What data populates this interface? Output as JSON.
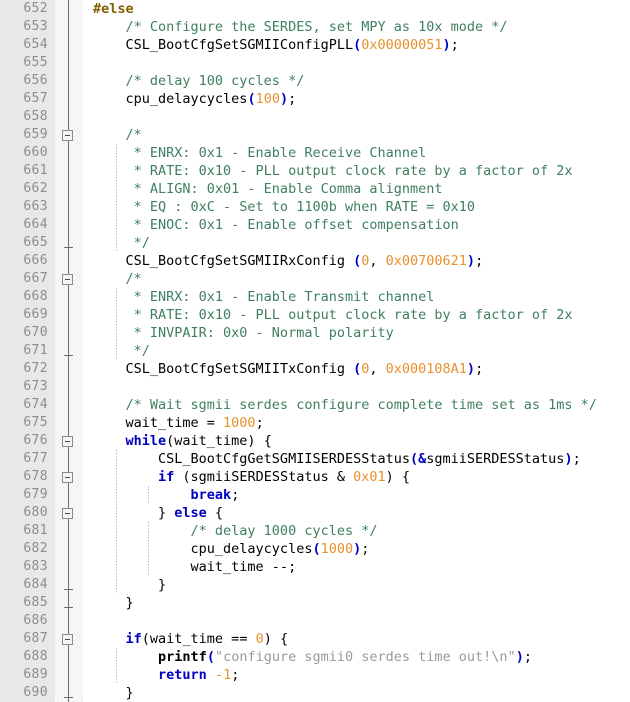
{
  "editor": {
    "name": "code-editor",
    "first_line": 652,
    "last_line": 690,
    "line_height": 18,
    "colors": {
      "gutter_bg": "#e8e8e8",
      "gutter_fg": "#8c8c8c",
      "code_bg": "#ffffff",
      "comment": "#3f7f5f",
      "keyword": "#0000c0",
      "preprocessor": "#7f5f00",
      "number": "#e8912d",
      "string": "#9a9a9a",
      "punctuation": "#0000c0",
      "indent_guide": "#bdbdbd",
      "fold_line": "#6e6e6e"
    }
  },
  "line_numbers": [
    "652",
    "653",
    "654",
    "655",
    "656",
    "657",
    "658",
    "659",
    "660",
    "661",
    "662",
    "663",
    "664",
    "665",
    "666",
    "667",
    "668",
    "669",
    "670",
    "671",
    "672",
    "673",
    "674",
    "675",
    "676",
    "677",
    "678",
    "679",
    "680",
    "681",
    "682",
    "683",
    "684",
    "685",
    "686",
    "687",
    "688",
    "689",
    "690"
  ],
  "lines": [
    {
      "number": "652",
      "fold": {
        "line": true,
        "box": false,
        "tick_top": false,
        "tick_bottom": false
      },
      "guides": [],
      "tokens": [
        {
          "t": "#else",
          "c": "pre"
        }
      ]
    },
    {
      "number": "653",
      "fold": {
        "line": true,
        "box": false,
        "tick_top": false,
        "tick_bottom": false
      },
      "guides": [],
      "tokens": [
        {
          "t": "    /* Configure the SERDES, set MPY as 10x mode */",
          "c": "cmt"
        }
      ]
    },
    {
      "number": "654",
      "fold": {
        "line": true,
        "box": false,
        "tick_top": false,
        "tick_bottom": false
      },
      "guides": [],
      "tokens": [
        {
          "t": "    CSL_BootCfgSetSGMIIConfigPLL",
          "c": "id"
        },
        {
          "t": "(",
          "c": "punc"
        },
        {
          "t": "0x00000051",
          "c": "num"
        },
        {
          "t": ")",
          "c": "punc"
        },
        {
          "t": ";",
          "c": "op"
        }
      ]
    },
    {
      "number": "655",
      "fold": {
        "line": true,
        "box": false,
        "tick_top": false,
        "tick_bottom": false
      },
      "guides": [],
      "tokens": []
    },
    {
      "number": "656",
      "fold": {
        "line": true,
        "box": false,
        "tick_top": false,
        "tick_bottom": false
      },
      "guides": [],
      "tokens": [
        {
          "t": "    /* delay 100 cycles */",
          "c": "cmt"
        }
      ]
    },
    {
      "number": "657",
      "fold": {
        "line": true,
        "box": false,
        "tick_top": false,
        "tick_bottom": false
      },
      "guides": [],
      "tokens": [
        {
          "t": "    cpu_delaycycles",
          "c": "id"
        },
        {
          "t": "(",
          "c": "punc"
        },
        {
          "t": "100",
          "c": "num"
        },
        {
          "t": ")",
          "c": "punc"
        },
        {
          "t": ";",
          "c": "op"
        }
      ]
    },
    {
      "number": "658",
      "fold": {
        "line": true,
        "box": false,
        "tick_top": false,
        "tick_bottom": false
      },
      "guides": [],
      "tokens": []
    },
    {
      "number": "659",
      "fold": {
        "line": true,
        "box": true,
        "tick_top": false,
        "tick_bottom": false
      },
      "guides": [],
      "tokens": [
        {
          "t": "    /*",
          "c": "cmt"
        }
      ]
    },
    {
      "number": "660",
      "fold": {
        "line": true,
        "box": false,
        "tick_top": false,
        "tick_bottom": false
      },
      "guides": [
        33
      ],
      "tokens": [
        {
          "t": "     * ENRX: 0x1 - Enable Receive Channel",
          "c": "cmt"
        }
      ]
    },
    {
      "number": "661",
      "fold": {
        "line": true,
        "box": false,
        "tick_top": false,
        "tick_bottom": false
      },
      "guides": [
        33
      ],
      "tokens": [
        {
          "t": "     * RATE: 0x10 - PLL output clock rate by a factor of 2x",
          "c": "cmt"
        }
      ]
    },
    {
      "number": "662",
      "fold": {
        "line": true,
        "box": false,
        "tick_top": false,
        "tick_bottom": false
      },
      "guides": [
        33
      ],
      "tokens": [
        {
          "t": "     * ALIGN: 0x01 - Enable Comma alignment",
          "c": "cmt"
        }
      ]
    },
    {
      "number": "663",
      "fold": {
        "line": true,
        "box": false,
        "tick_top": false,
        "tick_bottom": false
      },
      "guides": [
        33
      ],
      "tokens": [
        {
          "t": "     * EQ : 0xC - Set to 1100b when RATE = 0x10",
          "c": "cmt"
        }
      ]
    },
    {
      "number": "664",
      "fold": {
        "line": true,
        "box": false,
        "tick_top": false,
        "tick_bottom": false
      },
      "guides": [
        33
      ],
      "tokens": [
        {
          "t": "     * ENOC: 0x1 - Enable offset compensation",
          "c": "cmt"
        }
      ]
    },
    {
      "number": "665",
      "fold": {
        "line": true,
        "box": false,
        "tick_top": false,
        "tick_bottom": true
      },
      "guides": [
        33
      ],
      "tokens": [
        {
          "t": "     */",
          "c": "cmt"
        }
      ]
    },
    {
      "number": "666",
      "fold": {
        "line": true,
        "box": false,
        "tick_top": false,
        "tick_bottom": false
      },
      "guides": [],
      "tokens": [
        {
          "t": "    CSL_BootCfgSetSGMIIRxConfig ",
          "c": "id"
        },
        {
          "t": "(",
          "c": "punc"
        },
        {
          "t": "0",
          "c": "num"
        },
        {
          "t": ", ",
          "c": "op"
        },
        {
          "t": "0x00700621",
          "c": "num"
        },
        {
          "t": ")",
          "c": "punc"
        },
        {
          "t": ";",
          "c": "op"
        }
      ]
    },
    {
      "number": "667",
      "fold": {
        "line": true,
        "box": true,
        "tick_top": false,
        "tick_bottom": false
      },
      "guides": [],
      "tokens": [
        {
          "t": "    /*",
          "c": "cmt"
        }
      ]
    },
    {
      "number": "668",
      "fold": {
        "line": true,
        "box": false,
        "tick_top": false,
        "tick_bottom": false
      },
      "guides": [
        33
      ],
      "tokens": [
        {
          "t": "     * ENRX: 0x1 - Enable Transmit channel",
          "c": "cmt"
        }
      ]
    },
    {
      "number": "669",
      "fold": {
        "line": true,
        "box": false,
        "tick_top": false,
        "tick_bottom": false
      },
      "guides": [
        33
      ],
      "tokens": [
        {
          "t": "     * RATE: 0x10 - PLL output clock rate by a factor of 2x",
          "c": "cmt"
        }
      ]
    },
    {
      "number": "670",
      "fold": {
        "line": true,
        "box": false,
        "tick_top": false,
        "tick_bottom": false
      },
      "guides": [
        33
      ],
      "tokens": [
        {
          "t": "     * INVPAIR: 0x0 - Normal polarity",
          "c": "cmt"
        }
      ]
    },
    {
      "number": "671",
      "fold": {
        "line": true,
        "box": false,
        "tick_top": false,
        "tick_bottom": true
      },
      "guides": [
        33
      ],
      "tokens": [
        {
          "t": "     */",
          "c": "cmt"
        }
      ]
    },
    {
      "number": "672",
      "fold": {
        "line": true,
        "box": false,
        "tick_top": false,
        "tick_bottom": false
      },
      "guides": [],
      "tokens": [
        {
          "t": "    CSL_BootCfgSetSGMIITxConfig ",
          "c": "id"
        },
        {
          "t": "(",
          "c": "punc"
        },
        {
          "t": "0",
          "c": "num"
        },
        {
          "t": ", ",
          "c": "op"
        },
        {
          "t": "0x000108A1",
          "c": "num"
        },
        {
          "t": ")",
          "c": "punc"
        },
        {
          "t": ";",
          "c": "op"
        }
      ]
    },
    {
      "number": "673",
      "fold": {
        "line": true,
        "box": false,
        "tick_top": false,
        "tick_bottom": false
      },
      "guides": [],
      "tokens": []
    },
    {
      "number": "674",
      "fold": {
        "line": true,
        "box": false,
        "tick_top": false,
        "tick_bottom": false
      },
      "guides": [],
      "tokens": [
        {
          "t": "    /* Wait sgmii serdes configure complete time set as 1ms */",
          "c": "cmt"
        }
      ]
    },
    {
      "number": "675",
      "fold": {
        "line": true,
        "box": false,
        "tick_top": false,
        "tick_bottom": false
      },
      "guides": [],
      "tokens": [
        {
          "t": "    wait_time = ",
          "c": "id"
        },
        {
          "t": "1000",
          "c": "num"
        },
        {
          "t": ";",
          "c": "op"
        }
      ]
    },
    {
      "number": "676",
      "fold": {
        "line": true,
        "box": true,
        "tick_top": false,
        "tick_bottom": false
      },
      "guides": [],
      "tokens": [
        {
          "t": "    ",
          "c": "id"
        },
        {
          "t": "while",
          "c": "kwb"
        },
        {
          "t": "(wait_time) ",
          "c": "id"
        },
        {
          "t": "{",
          "c": "op"
        }
      ]
    },
    {
      "number": "677",
      "fold": {
        "line": true,
        "box": false,
        "tick_top": false,
        "tick_bottom": false
      },
      "guides": [
        33
      ],
      "tokens": [
        {
          "t": "        CSL_BootCfgGetSGMIISERDESStatus",
          "c": "id"
        },
        {
          "t": "(",
          "c": "punc"
        },
        {
          "t": "&",
          "c": "punc"
        },
        {
          "t": "sgmiiSERDESStatus",
          "c": "id"
        },
        {
          "t": ")",
          "c": "punc"
        },
        {
          "t": ";",
          "c": "op"
        }
      ]
    },
    {
      "number": "678",
      "fold": {
        "line": true,
        "box": true,
        "tick_top": false,
        "tick_bottom": false
      },
      "guides": [
        33
      ],
      "tokens": [
        {
          "t": "        ",
          "c": "id"
        },
        {
          "t": "if",
          "c": "kwb"
        },
        {
          "t": " (sgmiiSERDESStatus ",
          "c": "id"
        },
        {
          "t": "&",
          "c": "op"
        },
        {
          "t": " ",
          "c": "id"
        },
        {
          "t": "0x01",
          "c": "num"
        },
        {
          "t": ") {",
          "c": "op"
        }
      ]
    },
    {
      "number": "679",
      "fold": {
        "line": true,
        "box": false,
        "tick_top": false,
        "tick_bottom": false
      },
      "guides": [
        33,
        65
      ],
      "tokens": [
        {
          "t": "            ",
          "c": "id"
        },
        {
          "t": "break",
          "c": "kwb"
        },
        {
          "t": ";",
          "c": "op"
        }
      ]
    },
    {
      "number": "680",
      "fold": {
        "line": true,
        "box": true,
        "tick_top": false,
        "tick_bottom": false
      },
      "guides": [
        33
      ],
      "tokens": [
        {
          "t": "        } ",
          "c": "op"
        },
        {
          "t": "else",
          "c": "kwb"
        },
        {
          "t": " {",
          "c": "op"
        }
      ]
    },
    {
      "number": "681",
      "fold": {
        "line": true,
        "box": false,
        "tick_top": false,
        "tick_bottom": false
      },
      "guides": [
        33,
        65
      ],
      "tokens": [
        {
          "t": "            /* delay 1000 cycles */",
          "c": "cmt"
        }
      ]
    },
    {
      "number": "682",
      "fold": {
        "line": true,
        "box": false,
        "tick_top": false,
        "tick_bottom": false
      },
      "guides": [
        33,
        65
      ],
      "tokens": [
        {
          "t": "            cpu_delaycycles",
          "c": "id"
        },
        {
          "t": "(",
          "c": "punc"
        },
        {
          "t": "1000",
          "c": "num"
        },
        {
          "t": ")",
          "c": "punc"
        },
        {
          "t": ";",
          "c": "op"
        }
      ]
    },
    {
      "number": "683",
      "fold": {
        "line": true,
        "box": false,
        "tick_top": false,
        "tick_bottom": false
      },
      "guides": [
        33,
        65
      ],
      "tokens": [
        {
          "t": "            wait_time --;",
          "c": "id"
        }
      ]
    },
    {
      "number": "684",
      "fold": {
        "line": true,
        "box": false,
        "tick_top": false,
        "tick_bottom": true
      },
      "guides": [
        33
      ],
      "tokens": [
        {
          "t": "        }",
          "c": "op"
        }
      ]
    },
    {
      "number": "685",
      "fold": {
        "line": true,
        "box": false,
        "tick_top": false,
        "tick_bottom": true
      },
      "guides": [],
      "tokens": [
        {
          "t": "    }",
          "c": "op"
        }
      ]
    },
    {
      "number": "686",
      "fold": {
        "line": true,
        "box": false,
        "tick_top": false,
        "tick_bottom": false
      },
      "guides": [],
      "tokens": []
    },
    {
      "number": "687",
      "fold": {
        "line": true,
        "box": true,
        "tick_top": false,
        "tick_bottom": false
      },
      "guides": [],
      "tokens": [
        {
          "t": "    ",
          "c": "id"
        },
        {
          "t": "if",
          "c": "kwb"
        },
        {
          "t": "(wait_time == ",
          "c": "id"
        },
        {
          "t": "0",
          "c": "num"
        },
        {
          "t": ") {",
          "c": "op"
        }
      ]
    },
    {
      "number": "688",
      "fold": {
        "line": true,
        "box": false,
        "tick_top": false,
        "tick_bottom": false
      },
      "guides": [
        33
      ],
      "tokens": [
        {
          "t": "        ",
          "c": "id"
        },
        {
          "t": "printf",
          "c": "fn"
        },
        {
          "t": "(",
          "c": "punc"
        },
        {
          "t": "\"configure sgmii0 serdes time out!\\n\"",
          "c": "str"
        },
        {
          "t": ")",
          "c": "punc"
        },
        {
          "t": ";",
          "c": "op"
        }
      ]
    },
    {
      "number": "689",
      "fold": {
        "line": true,
        "box": false,
        "tick_top": false,
        "tick_bottom": false
      },
      "guides": [
        33
      ],
      "tokens": [
        {
          "t": "        ",
          "c": "id"
        },
        {
          "t": "return",
          "c": "kwb"
        },
        {
          "t": " ",
          "c": "id"
        },
        {
          "t": "-1",
          "c": "num"
        },
        {
          "t": ";",
          "c": "op"
        }
      ]
    },
    {
      "number": "690",
      "fold": {
        "line": true,
        "box": false,
        "tick_top": false,
        "tick_bottom": true
      },
      "guides": [],
      "tokens": [
        {
          "t": "    }",
          "c": "op"
        }
      ]
    }
  ]
}
